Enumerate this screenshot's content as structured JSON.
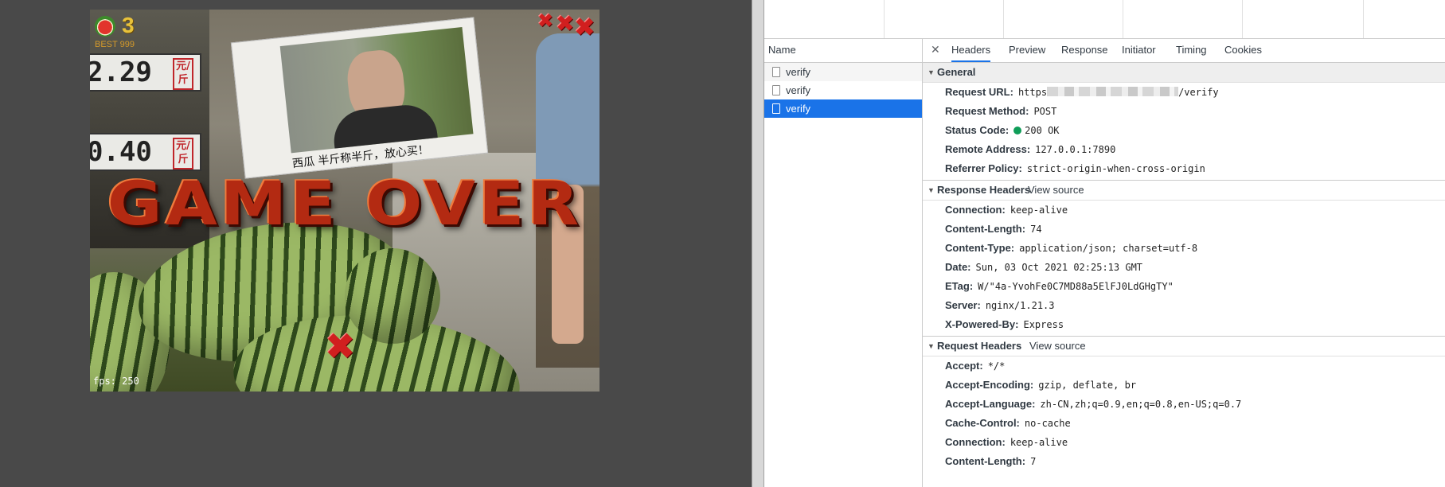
{
  "game": {
    "score": "3",
    "best": "BEST 999",
    "game_over": "GAME OVER",
    "fps": "fps: 250",
    "price1": "2.29",
    "price2": "0.40",
    "yuan": "元/斤",
    "poster_caption": "西瓜 半斤称半斤，放心买！"
  },
  "devtools": {
    "name_header": "Name",
    "requests": [
      {
        "name": "verify"
      },
      {
        "name": "verify"
      },
      {
        "name": "verify"
      }
    ],
    "tabs": [
      "Headers",
      "Preview",
      "Response",
      "Initiator",
      "Timing",
      "Cookies"
    ],
    "general": {
      "title": "General",
      "request_url_key": "Request URL:",
      "request_url_prefix": "https",
      "request_url_suffix": "/verify",
      "request_method_key": "Request Method:",
      "request_method": "POST",
      "status_code_key": "Status Code:",
      "status_code": "200 OK",
      "remote_address_key": "Remote Address:",
      "remote_address": "127.0.0.1:7890",
      "referrer_policy_key": "Referrer Policy:",
      "referrer_policy": "strict-origin-when-cross-origin"
    },
    "response_headers": {
      "title": "Response Headers",
      "view_source": "View source",
      "rows": [
        {
          "key": "Connection:",
          "value": "keep-alive"
        },
        {
          "key": "Content-Length:",
          "value": "74"
        },
        {
          "key": "Content-Type:",
          "value": "application/json; charset=utf-8"
        },
        {
          "key": "Date:",
          "value": "Sun, 03 Oct 2021 02:25:13 GMT"
        },
        {
          "key": "ETag:",
          "value": "W/\"4a-YvohFe0C7MD88a5ElFJ0LdGHgTY\""
        },
        {
          "key": "Server:",
          "value": "nginx/1.21.3"
        },
        {
          "key": "X-Powered-By:",
          "value": "Express"
        }
      ]
    },
    "request_headers": {
      "title": "Request Headers",
      "view_source": "View source",
      "rows": [
        {
          "key": "Accept:",
          "value": "*/*"
        },
        {
          "key": "Accept-Encoding:",
          "value": "gzip, deflate, br"
        },
        {
          "key": "Accept-Language:",
          "value": "zh-CN,zh;q=0.9,en;q=0.8,en-US;q=0.7"
        },
        {
          "key": "Cache-Control:",
          "value": "no-cache"
        },
        {
          "key": "Connection:",
          "value": "keep-alive"
        },
        {
          "key": "Content-Length:",
          "value": "7"
        }
      ]
    },
    "colors": {
      "selected": "#1a73e8",
      "status_ok": "#0f9d58"
    }
  }
}
